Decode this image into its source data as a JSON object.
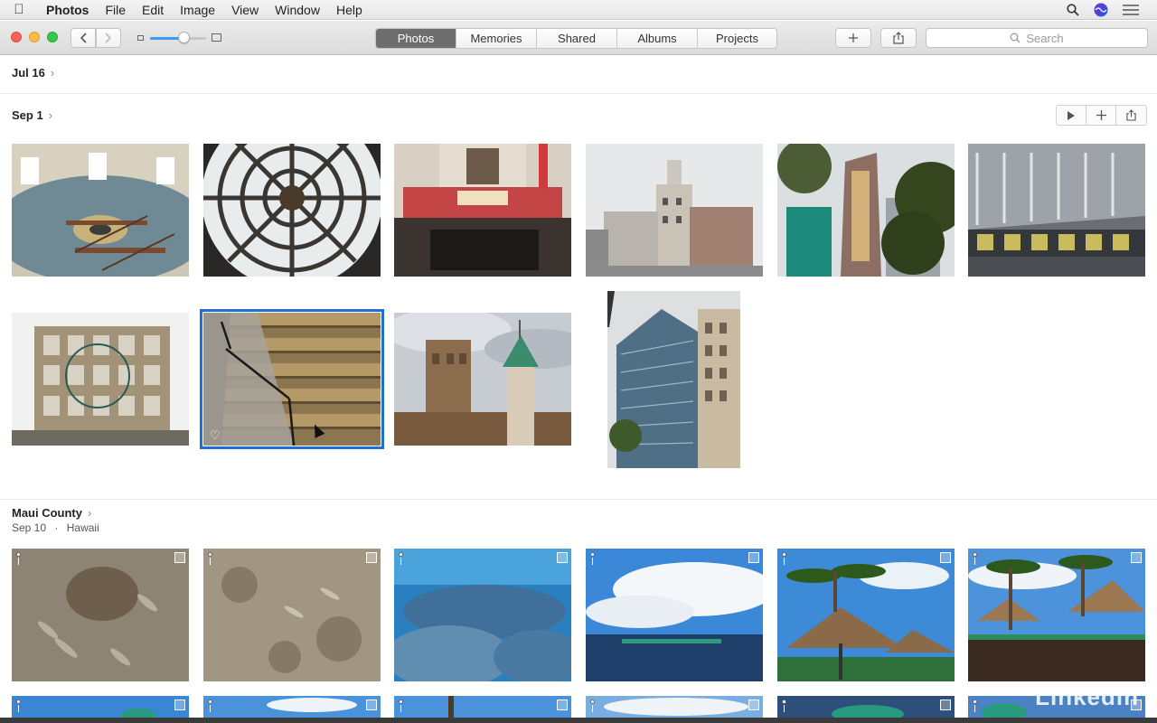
{
  "menubar": {
    "app": "Photos",
    "items": [
      "File",
      "Edit",
      "Image",
      "View",
      "Window",
      "Help"
    ]
  },
  "toolbar": {
    "tabs": [
      "Photos",
      "Memories",
      "Shared",
      "Albums",
      "Projects"
    ],
    "active_tab": "Photos",
    "search_placeholder": "Search",
    "zoom_level": 0.6
  },
  "sections": [
    {
      "title": "Jul 16"
    },
    {
      "title": "Sep 1"
    },
    {
      "title": "Maui County",
      "date": "Sep 10",
      "location": "Hawaii"
    }
  ],
  "separator": "·",
  "watermark": "Linkedin",
  "colors": {
    "accent": "#3b99fc",
    "selection": "#1e6fd6",
    "active_tab": "#6d6d6d"
  }
}
